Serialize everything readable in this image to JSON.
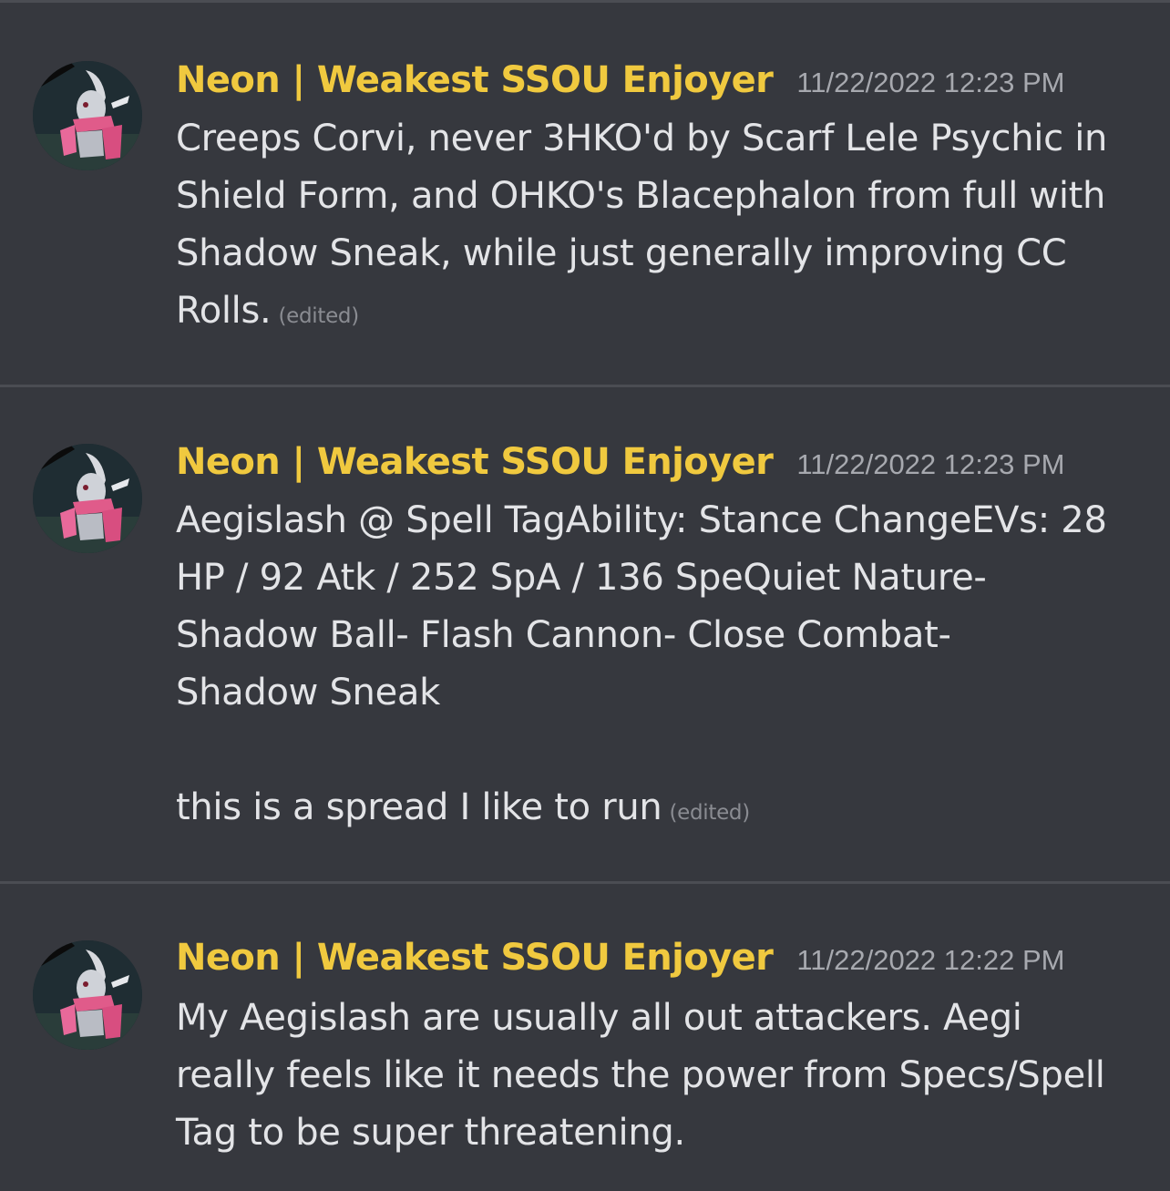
{
  "messages": [
    {
      "username": "Neon | Weakest SSOU Enjoyer",
      "timestamp": "11/22/2022 12:23 PM",
      "lines": [
        "Creeps Corvi, never 3HKO'd by Scarf Lele Psychic in",
        "Shield Form, and OHKO's Blacephalon from full with",
        "Shadow Sneak, while just generally improving CC",
        "Rolls."
      ],
      "edited_label": "(edited)"
    },
    {
      "username": "Neon | Weakest SSOU Enjoyer",
      "timestamp": "11/22/2022 12:23 PM",
      "lines": [
        "Aegislash @ Spell TagAbility: Stance ChangeEVs: 28",
        "HP / 92 Atk / 252 SpA / 136 SpeQuiet Nature-",
        "Shadow Ball- Flash Cannon- Close Combat-",
        "Shadow Sneak"
      ],
      "trailing_line": "this is a spread I like to run",
      "edited_label": "(edited)"
    },
    {
      "username": "Neon | Weakest SSOU Enjoyer",
      "timestamp": "11/22/2022 12:22 PM",
      "lines": [
        "My Aegislash are usually all out attackers. Aegi",
        "really feels like it needs the power from Specs/Spell",
        "Tag to be super threatening."
      ]
    }
  ],
  "colors": {
    "background": "#36383e",
    "separator": "#4b4d53",
    "username": "#f0c93f",
    "text": "#e3e4e7",
    "timestamp": "#a7a9af",
    "edited": "#8a8c92"
  },
  "icons": {
    "avatar": "aegislash-avatar-icon"
  }
}
